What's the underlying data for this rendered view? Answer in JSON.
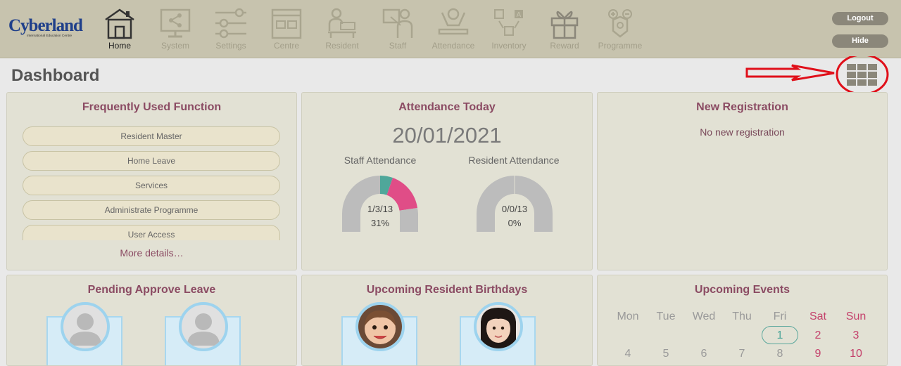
{
  "brand": {
    "name": "Cyberland",
    "subtitle": "International Education Centre"
  },
  "nav": [
    {
      "label": "Home",
      "icon": "home-icon"
    },
    {
      "label": "System",
      "icon": "share-monitor-icon"
    },
    {
      "label": "Settings",
      "icon": "sliders-icon"
    },
    {
      "label": "Centre",
      "icon": "building-icon"
    },
    {
      "label": "Resident",
      "icon": "resident-desk-icon"
    },
    {
      "label": "Staff",
      "icon": "staff-board-icon"
    },
    {
      "label": "Attendance",
      "icon": "attendance-person-icon"
    },
    {
      "label": "Inventory",
      "icon": "inventory-flow-icon"
    },
    {
      "label": "Reward",
      "icon": "gift-icon"
    },
    {
      "label": "Programme",
      "icon": "programme-icon"
    }
  ],
  "top_buttons": {
    "logout": "Logout",
    "hide": "Hide"
  },
  "page_title": "Dashboard",
  "frequent": {
    "title": "Frequently Used Function",
    "items": [
      "Resident Master",
      "Home Leave",
      "Services",
      "Administrate Programme",
      "User Access"
    ],
    "more": "More details…"
  },
  "attendance": {
    "title": "Attendance Today",
    "date": "20/01/2021",
    "staff": {
      "label": "Staff Attendance",
      "counts": "1/3/13",
      "percent": "31%"
    },
    "resident": {
      "label": "Resident Attendance",
      "counts": "0/0/13",
      "percent": "0%"
    }
  },
  "registration": {
    "title": "New Registration",
    "empty": "No new registration"
  },
  "leave": {
    "title": "Pending Approve Leave"
  },
  "birthdays": {
    "title": "Upcoming Resident Birthdays"
  },
  "events": {
    "title": "Upcoming Events",
    "days": [
      "Mon",
      "Tue",
      "Wed",
      "Thu",
      "Fri",
      "Sat",
      "Sun"
    ],
    "row1": [
      "1",
      "2",
      "3"
    ],
    "row2": [
      "4",
      "5",
      "6",
      "7",
      "8",
      "9",
      "10"
    ]
  },
  "colors": {
    "topbar": "#c7c3ae",
    "accent": "#8b4b63",
    "teal": "#4fa79a",
    "pink": "#e04d87",
    "annotation": "#e0101a"
  }
}
